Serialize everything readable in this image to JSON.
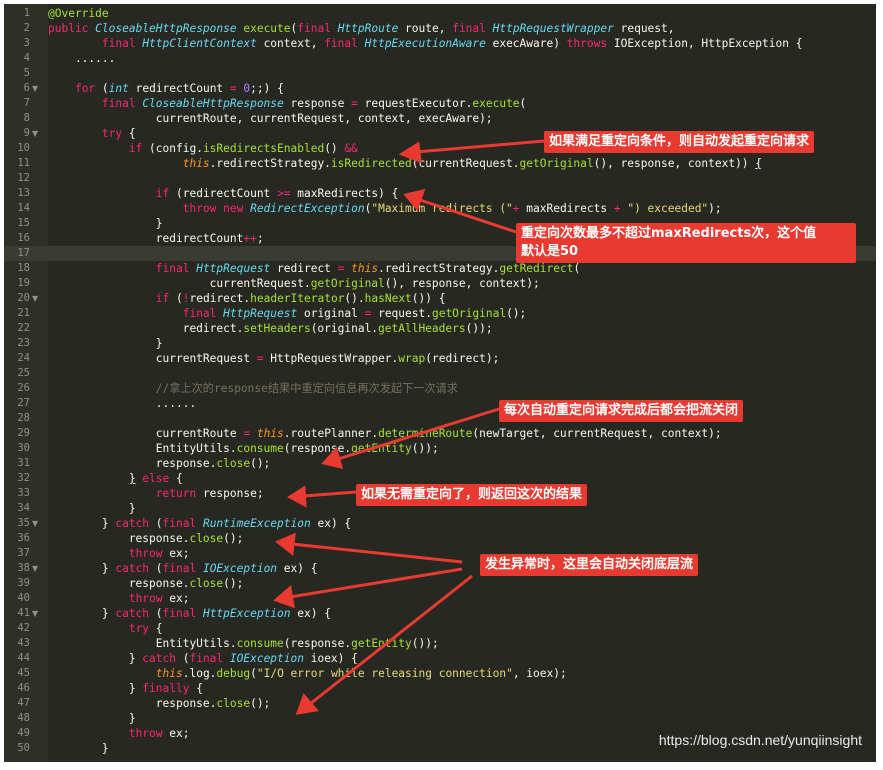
{
  "lines": [
    {
      "n": "1",
      "parts": [
        {
          "t": "@Override",
          "c": "ann"
        }
      ]
    },
    {
      "n": "2",
      "parts": [
        {
          "t": "public ",
          "c": "kw"
        },
        {
          "t": "CloseableHttpResponse",
          "c": "ty"
        },
        {
          "t": " "
        },
        {
          "t": "execute",
          "c": "fn"
        },
        {
          "t": "("
        },
        {
          "t": "final ",
          "c": "kw"
        },
        {
          "t": "HttpRoute",
          "c": "ty"
        },
        {
          "t": " route, "
        },
        {
          "t": "final ",
          "c": "kw"
        },
        {
          "t": "HttpRequestWrapper",
          "c": "ty"
        },
        {
          "t": " request,"
        }
      ]
    },
    {
      "n": "3",
      "parts": [
        {
          "t": "        "
        },
        {
          "t": "final ",
          "c": "kw"
        },
        {
          "t": "HttpClientContext",
          "c": "ty"
        },
        {
          "t": " context, "
        },
        {
          "t": "final ",
          "c": "kw"
        },
        {
          "t": "HttpExecutionAware",
          "c": "ty"
        },
        {
          "t": " execAware) "
        },
        {
          "t": "throws ",
          "c": "kw"
        },
        {
          "t": "IOException, HttpException {"
        }
      ]
    },
    {
      "n": "4",
      "parts": [
        {
          "t": "    ......"
        }
      ]
    },
    {
      "n": "5",
      "parts": []
    },
    {
      "n": "6",
      "fold": true,
      "parts": [
        {
          "t": "    "
        },
        {
          "t": "for ",
          "c": "kw"
        },
        {
          "t": "("
        },
        {
          "t": "int",
          "c": "ty"
        },
        {
          "t": " redirectCount "
        },
        {
          "t": "=",
          "c": "kw"
        },
        {
          "t": " "
        },
        {
          "t": "0",
          "c": "num"
        },
        {
          "t": ";;) {"
        }
      ]
    },
    {
      "n": "7",
      "parts": [
        {
          "t": "        "
        },
        {
          "t": "final ",
          "c": "kw"
        },
        {
          "t": "CloseableHttpResponse",
          "c": "ty"
        },
        {
          "t": " response "
        },
        {
          "t": "=",
          "c": "kw"
        },
        {
          "t": " requestExecutor."
        },
        {
          "t": "execute",
          "c": "fn"
        },
        {
          "t": "("
        }
      ]
    },
    {
      "n": "8",
      "parts": [
        {
          "t": "                currentRoute, currentRequest, context, execAware);"
        }
      ]
    },
    {
      "n": "9",
      "fold": true,
      "parts": [
        {
          "t": "        "
        },
        {
          "t": "try",
          "c": "kw"
        },
        {
          "t": " {"
        }
      ]
    },
    {
      "n": "10",
      "parts": [
        {
          "t": "            "
        },
        {
          "t": "if ",
          "c": "kw"
        },
        {
          "t": "(config."
        },
        {
          "t": "isRedirectsEnabled",
          "c": "fn"
        },
        {
          "t": "() "
        },
        {
          "t": "&&",
          "c": "kw"
        }
      ]
    },
    {
      "n": "11",
      "parts": [
        {
          "t": "                    "
        },
        {
          "t": "this",
          "c": "this"
        },
        {
          "t": ".redirectStrategy."
        },
        {
          "t": "isRedirected",
          "c": "fn"
        },
        {
          "t": "(currentRequest."
        },
        {
          "t": "getOriginal",
          "c": "fn"
        },
        {
          "t": "(), response, context)) "
        },
        {
          "t": "{",
          "c": "ul"
        }
      ]
    },
    {
      "n": "12",
      "parts": []
    },
    {
      "n": "13",
      "parts": [
        {
          "t": "                "
        },
        {
          "t": "if ",
          "c": "kw"
        },
        {
          "t": "(redirectCount "
        },
        {
          "t": ">=",
          "c": "kw"
        },
        {
          "t": " maxRedirects) {"
        }
      ]
    },
    {
      "n": "14",
      "parts": [
        {
          "t": "                    "
        },
        {
          "t": "throw new ",
          "c": "kw"
        },
        {
          "t": "RedirectException",
          "c": "ty"
        },
        {
          "t": "("
        },
        {
          "t": "\"Maximum redirects (\"",
          "c": "str"
        },
        {
          "t": "+",
          "c": "kw"
        },
        {
          "t": " maxRedirects "
        },
        {
          "t": "+",
          "c": "kw"
        },
        {
          "t": " "
        },
        {
          "t": "\") exceeded\"",
          "c": "str"
        },
        {
          "t": ");"
        }
      ]
    },
    {
      "n": "15",
      "parts": [
        {
          "t": "                }"
        }
      ]
    },
    {
      "n": "16",
      "parts": [
        {
          "t": "                redirectCount"
        },
        {
          "t": "++",
          "c": "kw"
        },
        {
          "t": ";"
        }
      ]
    },
    {
      "n": "17",
      "active": true,
      "parts": []
    },
    {
      "n": "18",
      "parts": [
        {
          "t": "                "
        },
        {
          "t": "final ",
          "c": "kw"
        },
        {
          "t": "HttpRequest",
          "c": "ty"
        },
        {
          "t": " redirect "
        },
        {
          "t": "=",
          "c": "kw"
        },
        {
          "t": " "
        },
        {
          "t": "this",
          "c": "this"
        },
        {
          "t": ".redirectStrategy."
        },
        {
          "t": "getRedirect",
          "c": "fn"
        },
        {
          "t": "("
        }
      ]
    },
    {
      "n": "19",
      "parts": [
        {
          "t": "                        currentRequest."
        },
        {
          "t": "getOriginal",
          "c": "fn"
        },
        {
          "t": "(), response, context);"
        }
      ]
    },
    {
      "n": "20",
      "fold": true,
      "parts": [
        {
          "t": "                "
        },
        {
          "t": "if ",
          "c": "kw"
        },
        {
          "t": "("
        },
        {
          "t": "!",
          "c": "kw"
        },
        {
          "t": "redirect."
        },
        {
          "t": "headerIterator",
          "c": "fn"
        },
        {
          "t": "()."
        },
        {
          "t": "hasNext",
          "c": "fn"
        },
        {
          "t": "()) {"
        }
      ]
    },
    {
      "n": "21",
      "parts": [
        {
          "t": "                    "
        },
        {
          "t": "final ",
          "c": "kw"
        },
        {
          "t": "HttpRequest",
          "c": "ty"
        },
        {
          "t": " original "
        },
        {
          "t": "=",
          "c": "kw"
        },
        {
          "t": " request."
        },
        {
          "t": "getOriginal",
          "c": "fn"
        },
        {
          "t": "();"
        }
      ]
    },
    {
      "n": "22",
      "parts": [
        {
          "t": "                    redirect."
        },
        {
          "t": "setHeaders",
          "c": "fn"
        },
        {
          "t": "(original."
        },
        {
          "t": "getAllHeaders",
          "c": "fn"
        },
        {
          "t": "());"
        }
      ]
    },
    {
      "n": "23",
      "parts": [
        {
          "t": "                }"
        }
      ]
    },
    {
      "n": "24",
      "parts": [
        {
          "t": "                currentRequest "
        },
        {
          "t": "=",
          "c": "kw"
        },
        {
          "t": " HttpRequestWrapper."
        },
        {
          "t": "wrap",
          "c": "fn"
        },
        {
          "t": "(redirect);"
        }
      ]
    },
    {
      "n": "25",
      "parts": []
    },
    {
      "n": "26",
      "parts": [
        {
          "t": "                //拿上次的response结果中重定向信息再次发起下一次请求",
          "c": "cm"
        }
      ]
    },
    {
      "n": "27",
      "parts": [
        {
          "t": "                ......"
        }
      ]
    },
    {
      "n": "28",
      "parts": []
    },
    {
      "n": "29",
      "parts": [
        {
          "t": "                currentRoute "
        },
        {
          "t": "=",
          "c": "kw"
        },
        {
          "t": " "
        },
        {
          "t": "this",
          "c": "this"
        },
        {
          "t": ".routePlanner."
        },
        {
          "t": "determineRoute",
          "c": "fn"
        },
        {
          "t": "(newTarget, currentRequest, context);"
        }
      ]
    },
    {
      "n": "30",
      "parts": [
        {
          "t": "                EntityUtils."
        },
        {
          "t": "consume",
          "c": "fn"
        },
        {
          "t": "(response."
        },
        {
          "t": "getEntity",
          "c": "fn"
        },
        {
          "t": "());"
        }
      ]
    },
    {
      "n": "31",
      "parts": [
        {
          "t": "                response."
        },
        {
          "t": "close",
          "c": "fn"
        },
        {
          "t": "();"
        }
      ]
    },
    {
      "n": "32",
      "parts": [
        {
          "t": "            "
        },
        {
          "t": "}",
          "c": "ul"
        },
        {
          "t": " "
        },
        {
          "t": "else",
          "c": "kw"
        },
        {
          "t": " {"
        }
      ]
    },
    {
      "n": "33",
      "parts": [
        {
          "t": "                "
        },
        {
          "t": "return ",
          "c": "kw"
        },
        {
          "t": "response;"
        }
      ]
    },
    {
      "n": "34",
      "parts": [
        {
          "t": "            }"
        }
      ]
    },
    {
      "n": "35",
      "fold": true,
      "parts": [
        {
          "t": "        } "
        },
        {
          "t": "catch ",
          "c": "kw"
        },
        {
          "t": "("
        },
        {
          "t": "final ",
          "c": "kw"
        },
        {
          "t": "RuntimeException",
          "c": "ty"
        },
        {
          "t": " ex) {"
        }
      ]
    },
    {
      "n": "36",
      "parts": [
        {
          "t": "            response."
        },
        {
          "t": "close",
          "c": "fn"
        },
        {
          "t": "();"
        }
      ]
    },
    {
      "n": "37",
      "parts": [
        {
          "t": "            "
        },
        {
          "t": "throw ",
          "c": "kw"
        },
        {
          "t": "ex;"
        }
      ]
    },
    {
      "n": "38",
      "fold": true,
      "parts": [
        {
          "t": "        } "
        },
        {
          "t": "catch ",
          "c": "kw"
        },
        {
          "t": "("
        },
        {
          "t": "final ",
          "c": "kw"
        },
        {
          "t": "IOException",
          "c": "ty"
        },
        {
          "t": " ex) {"
        }
      ]
    },
    {
      "n": "39",
      "parts": [
        {
          "t": "            response."
        },
        {
          "t": "close",
          "c": "fn"
        },
        {
          "t": "();"
        }
      ]
    },
    {
      "n": "40",
      "parts": [
        {
          "t": "            "
        },
        {
          "t": "throw ",
          "c": "kw"
        },
        {
          "t": "ex;"
        }
      ]
    },
    {
      "n": "41",
      "fold": true,
      "parts": [
        {
          "t": "        } "
        },
        {
          "t": "catch ",
          "c": "kw"
        },
        {
          "t": "("
        },
        {
          "t": "final ",
          "c": "kw"
        },
        {
          "t": "HttpException",
          "c": "ty"
        },
        {
          "t": " ex) {"
        }
      ]
    },
    {
      "n": "42",
      "parts": [
        {
          "t": "            "
        },
        {
          "t": "try",
          "c": "kw"
        },
        {
          "t": " {"
        }
      ]
    },
    {
      "n": "43",
      "parts": [
        {
          "t": "                EntityUtils."
        },
        {
          "t": "consume",
          "c": "fn"
        },
        {
          "t": "(response."
        },
        {
          "t": "getEntity",
          "c": "fn"
        },
        {
          "t": "());"
        }
      ]
    },
    {
      "n": "44",
      "parts": [
        {
          "t": "            } "
        },
        {
          "t": "catch ",
          "c": "kw"
        },
        {
          "t": "("
        },
        {
          "t": "final ",
          "c": "kw"
        },
        {
          "t": "IOException",
          "c": "ty"
        },
        {
          "t": " ioex) {"
        }
      ]
    },
    {
      "n": "45",
      "parts": [
        {
          "t": "                "
        },
        {
          "t": "this",
          "c": "this"
        },
        {
          "t": ".log."
        },
        {
          "t": "debug",
          "c": "fn"
        },
        {
          "t": "("
        },
        {
          "t": "\"I/O error while releasing connection\"",
          "c": "str"
        },
        {
          "t": ", ioex);"
        }
      ]
    },
    {
      "n": "46",
      "parts": [
        {
          "t": "            } "
        },
        {
          "t": "finally",
          "c": "kw"
        },
        {
          "t": " {"
        }
      ]
    },
    {
      "n": "47",
      "parts": [
        {
          "t": "                response."
        },
        {
          "t": "close",
          "c": "fn"
        },
        {
          "t": "();"
        }
      ]
    },
    {
      "n": "48",
      "parts": [
        {
          "t": "            }"
        }
      ]
    },
    {
      "n": "49",
      "parts": [
        {
          "t": "            "
        },
        {
          "t": "throw ",
          "c": "kw"
        },
        {
          "t": "ex;"
        }
      ]
    },
    {
      "n": "50",
      "parts": [
        {
          "t": "        }"
        }
      ]
    }
  ],
  "callouts": {
    "c1": "如果满足重定向条件，则自动发起重定向请求",
    "c2_line1": "重定向次数最多不超过maxRedirects次，这个值",
    "c2_line2": "默认是50",
    "c3": "每次自动重定向请求完成后都会把流关闭",
    "c4": "如果无需重定向了，则返回这次的结果",
    "c5": "发生异常时，这里会自动关闭底层流"
  },
  "watermark": "https://blog.csdn.net/yunqiinsight",
  "colors": {
    "background": "#272822",
    "keyword": "#f92672",
    "type": "#66d9ef",
    "function": "#a6e22e",
    "string": "#e6db74",
    "callout": "#e83a30",
    "arrow": "#e83a30"
  }
}
